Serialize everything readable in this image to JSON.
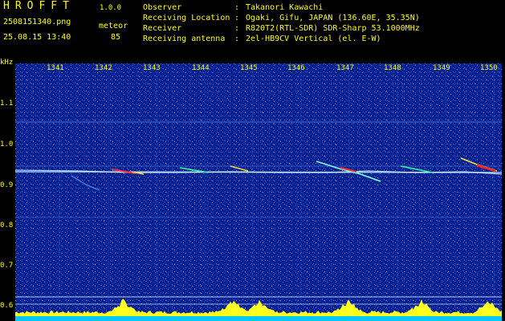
{
  "header": {
    "app_title": "HROFFT",
    "version": "1.0.0",
    "filename": "2508151340.png",
    "mode": "meteor",
    "datetime": "25.08.15 13:40",
    "count": "85"
  },
  "info": [
    {
      "label": "Observer",
      "value": "Takanori Kawachi"
    },
    {
      "label": "Receiving Location",
      "value": "Ogaki, Gifu, JAPAN (136.60E, 35.35N)"
    },
    {
      "label": "Receiver",
      "value": "R820T2(RTL-SDR) SDR-Sharp 53.1000MHz"
    },
    {
      "label": "Receiving antenna",
      "value": "2el-HB9CV Vertical (el. E-W)"
    }
  ],
  "info_sep": ":",
  "yaxis": {
    "unit": "kHz",
    "labels": [
      "1.1",
      "1.0",
      "0.9",
      "0.8",
      "0.7",
      "0.6"
    ]
  },
  "xaxis": {
    "labels": [
      "1341",
      "1342",
      "1343",
      "1344",
      "1345",
      "1346",
      "1347",
      "1348",
      "1349",
      "1350"
    ]
  },
  "colors": {
    "background": "#07208c",
    "text": "#ffff00",
    "baseline": "#ffff00",
    "echo_line": "#d0f0ff",
    "signal_red": "#ff2a2a"
  }
}
